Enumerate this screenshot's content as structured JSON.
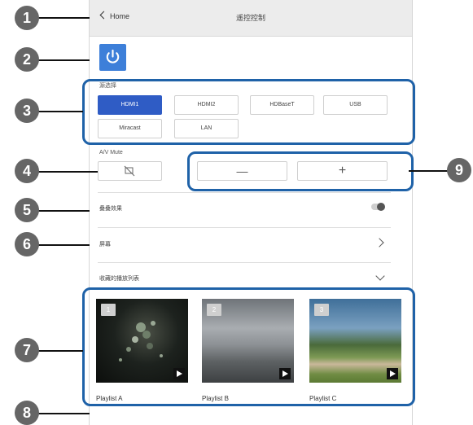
{
  "header": {
    "back_label": "Home",
    "title": "遥控控制"
  },
  "power": {
    "icon": "power-icon",
    "color": "#3d7fd9"
  },
  "source": {
    "section_label": "源选择",
    "buttons": [
      {
        "label": "HDMI1",
        "active": true
      },
      {
        "label": "HDMI2",
        "active": false
      },
      {
        "label": "HDBaseT",
        "active": false
      },
      {
        "label": "USB",
        "active": false
      },
      {
        "label": "Miracast",
        "active": false
      },
      {
        "label": "LAN",
        "active": false
      }
    ]
  },
  "av_mute": {
    "label": "A/V Mute",
    "icon": "av-mute-icon"
  },
  "volume": {
    "minus_label": "—",
    "plus_label": "+"
  },
  "settings": {
    "overlay_label": "叠叠效果",
    "screen_label": "屏幕",
    "playlist_label": "收藏的播放列表"
  },
  "playlists": [
    {
      "number": "1",
      "name": "Playlist A"
    },
    {
      "number": "2",
      "name": "Playlist B"
    },
    {
      "number": "3",
      "name": "Playlist C"
    }
  ],
  "callouts": [
    "1",
    "2",
    "3",
    "4",
    "5",
    "6",
    "7",
    "8",
    "9"
  ],
  "colors": {
    "accent": "#2f5cc5",
    "outline": "#1f62a8",
    "callout": "#666666"
  }
}
